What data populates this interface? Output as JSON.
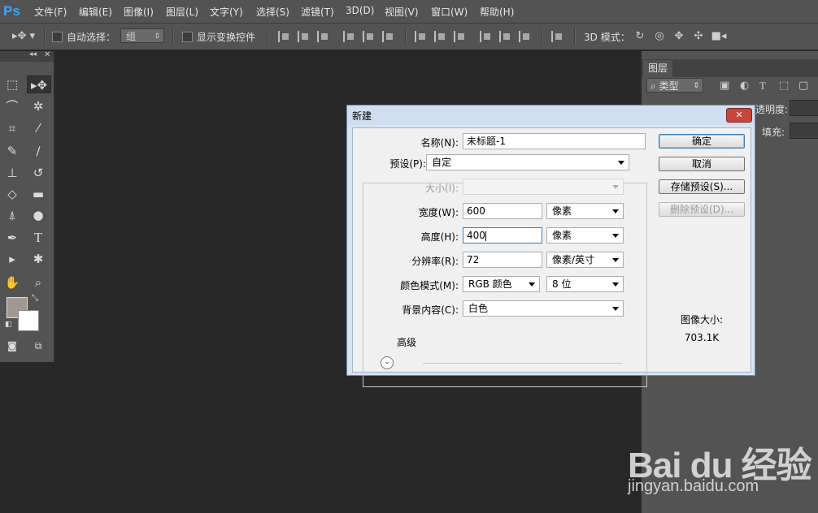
{
  "app": {
    "logo": "Ps"
  },
  "menu": [
    "文件(F)",
    "编辑(E)",
    "图像(I)",
    "图层(L)",
    "文字(Y)",
    "选择(S)",
    "滤镜(T)",
    "3D(D)",
    "视图(V)",
    "窗口(W)",
    "帮助(H)"
  ],
  "options_bar": {
    "auto_select_label": "自动选择：",
    "auto_select_value": "组",
    "show_transform_label": "显示变换控件",
    "mode_3d_label": "3D 模式："
  },
  "layers_panel": {
    "tab_label": "图层",
    "filter_label": "类型",
    "opacity_label": "透明度:",
    "fill_label": "填充:"
  },
  "dialog": {
    "title": "新建",
    "close_label": "✕",
    "name_label": "名称(N):",
    "name_value": "未标题-1",
    "preset_label": "预设(P):",
    "preset_value": "自定",
    "size_label": "大小(I):",
    "size_value": "",
    "width_label": "宽度(W):",
    "width_value": "600",
    "width_unit": "像素",
    "height_label": "高度(H):",
    "height_value": "400",
    "height_unit": "像素",
    "resolution_label": "分辨率(R):",
    "resolution_value": "72",
    "resolution_unit": "像素/英寸",
    "color_mode_label": "颜色模式(M):",
    "color_mode_value": "RGB 颜色",
    "bit_depth_value": "8 位",
    "bg_contents_label": "背景内容(C):",
    "bg_contents_value": "白色",
    "advanced_label": "高级",
    "ok_label": "确定",
    "cancel_label": "取消",
    "save_preset_label": "存储预设(S)...",
    "delete_preset_label": "删除预设(D)...",
    "image_size_label": "图像大小:",
    "image_size_value": "703.1K"
  },
  "colors": {
    "foreground": "#a39794",
    "background": "#ffffff",
    "accent": "#31a8ff"
  },
  "icons": [
    "move-icon",
    "marquee-icon",
    "lasso-icon",
    "magic-wand-icon",
    "crop-icon",
    "eyedropper-icon",
    "healing-brush-icon",
    "brush-icon",
    "stamp-icon",
    "history-brush-icon",
    "eraser-icon",
    "gradient-icon",
    "blur-icon",
    "dodge-icon",
    "pen-icon",
    "type-icon",
    "path-select-icon",
    "shape-icon",
    "hand-icon",
    "zoom-icon"
  ],
  "watermark": {
    "logo": "Bai du 经验",
    "url": "jingyan.baidu.com"
  }
}
